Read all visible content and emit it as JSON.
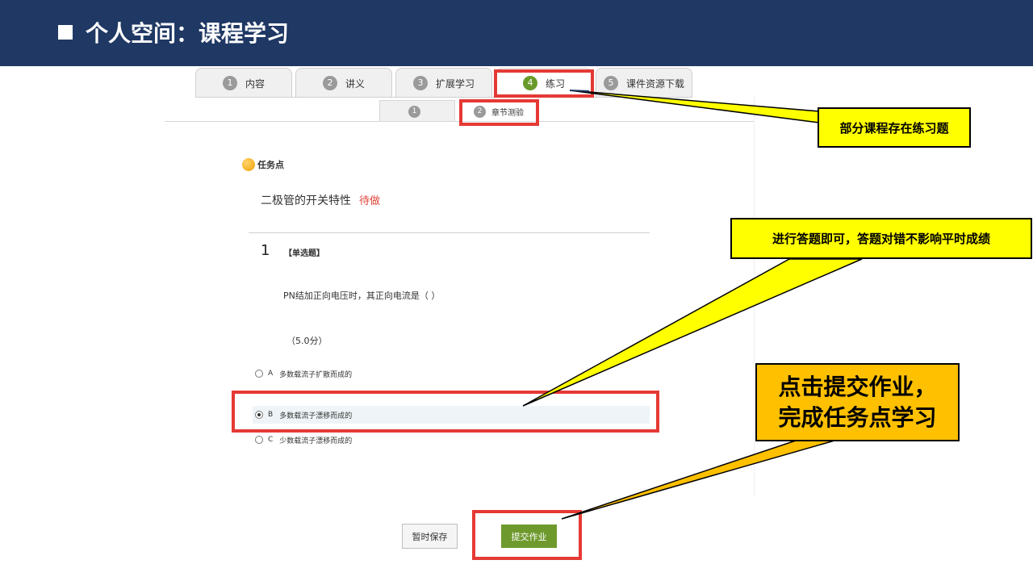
{
  "header": {
    "title": "个人空间：课程学习"
  },
  "tabs": [
    {
      "num": "1",
      "label": "内容"
    },
    {
      "num": "2",
      "label": "讲义"
    },
    {
      "num": "3",
      "label": "扩展学习"
    },
    {
      "num": "4",
      "label": "练习"
    },
    {
      "num": "5",
      "label": "课件资源下载"
    }
  ],
  "subtabs": [
    {
      "num": "1",
      "label": ""
    },
    {
      "num": "2",
      "label": "章节测验"
    }
  ],
  "task": {
    "badge": "任务点",
    "title": "二极管的开关特性",
    "status": "待做"
  },
  "question": {
    "number": "1",
    "type": "【单选题】",
    "text": "PN结加正向电压时，其正向电流是（ ）",
    "score": "（5.0分）",
    "options": [
      {
        "letter": "A",
        "text": "多数载流子扩散而成的"
      },
      {
        "letter": "B",
        "text": "多数载流子漂移而成的"
      },
      {
        "letter": "C",
        "text": "少数载流子漂移而成的"
      }
    ],
    "selected": "B"
  },
  "buttons": {
    "save": "暂时保存",
    "submit": "提交作业"
  },
  "callouts": {
    "practice": "部分课程存在练习题",
    "answer": "进行答题即可，答题对错不影响平时成绩",
    "submit_line1": "点击提交作业，",
    "submit_line2": "完成任务点学习"
  },
  "colors": {
    "header_bg": "#1f3864",
    "accent_green": "#6e9a2d",
    "highlight_red": "#e53935",
    "callout_yellow": "#ffff00",
    "callout_orange": "#ffc000",
    "status_red": "#e0443a"
  }
}
